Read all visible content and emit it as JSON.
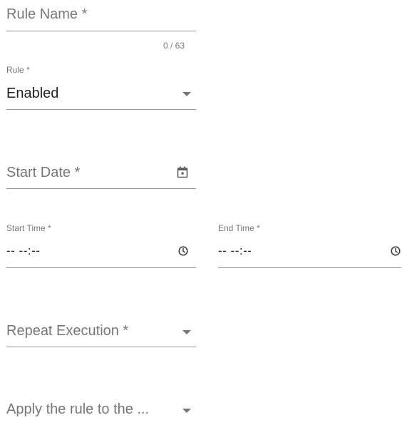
{
  "form": {
    "rule_name": {
      "placeholder": "Rule Name *",
      "counter": "0 / 63"
    },
    "rule": {
      "label": "Rule *",
      "value": "Enabled",
      "icon": "dropdown-arrow-icon"
    },
    "start_date": {
      "placeholder": "Start Date *",
      "icon": "calendar-icon"
    },
    "start_time": {
      "label": "Start Time *",
      "value": "-- --:--",
      "icon": "clock-icon"
    },
    "end_time": {
      "label": "End Time *",
      "value": "-- --:--",
      "icon": "clock-icon"
    },
    "repeat_execution": {
      "placeholder": "Repeat Execution *",
      "icon": "dropdown-arrow-icon"
    },
    "apply_rule": {
      "placeholder": "Apply the rule to the ...",
      "icon": "dropdown-arrow-icon"
    }
  },
  "colors": {
    "text_primary": "#212121",
    "text_secondary": "#8a8a8a",
    "underline": "#949494",
    "icon": "#5f5f5f"
  }
}
